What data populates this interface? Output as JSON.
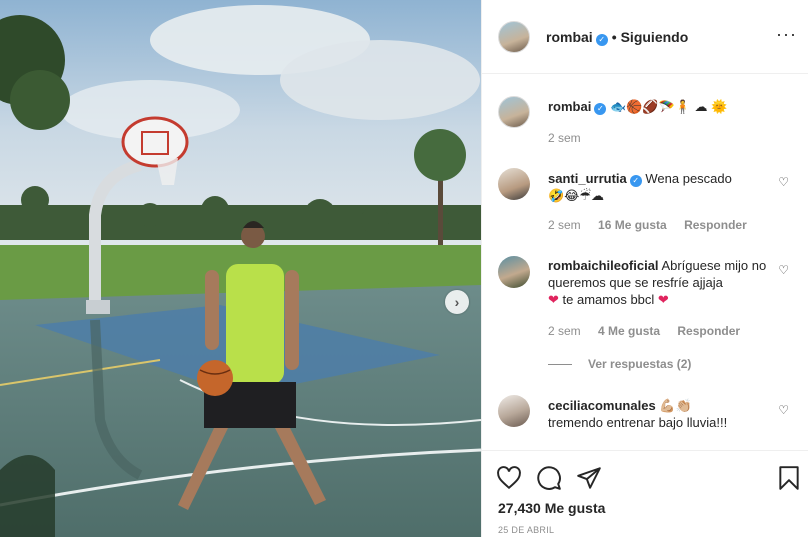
{
  "post": {
    "username": "rombai",
    "following_label": "Siguiendo",
    "more_icon": "more-horizontal-icon",
    "next_icon": "chevron-right-icon"
  },
  "caption": {
    "username": "rombai",
    "emojis": "🐟🏀🏈🪂🧍 ☁ 🌞",
    "time": "2 sem"
  },
  "comments": [
    {
      "username": "santi_urrutia",
      "verified": true,
      "text": "Wena pescado",
      "line2": "🤣😂☔☁",
      "time": "2 sem",
      "likes": "16 Me gusta",
      "reply": "Responder"
    },
    {
      "username": "rombaichileoficial",
      "text": "Abríguese mijo no queremos que se resfríe ajjaja",
      "line3": "te amamos bbcl",
      "time": "2 sem",
      "likes": "4 Me gusta",
      "reply": "Responder"
    },
    {
      "view_replies": "Ver respuestas (2)"
    },
    {
      "username": "ceciliacomunales",
      "text": "💪🏼👏🏼",
      "line2": "tremendo entrenar bajo lluvia!!!"
    }
  ],
  "actions": {
    "likes": "27,430 Me gusta",
    "date": "25 DE ABRIL"
  },
  "colors": {
    "verified": "#3897f0",
    "meta_gray": "#8e8e8e",
    "border": "#efefef"
  }
}
